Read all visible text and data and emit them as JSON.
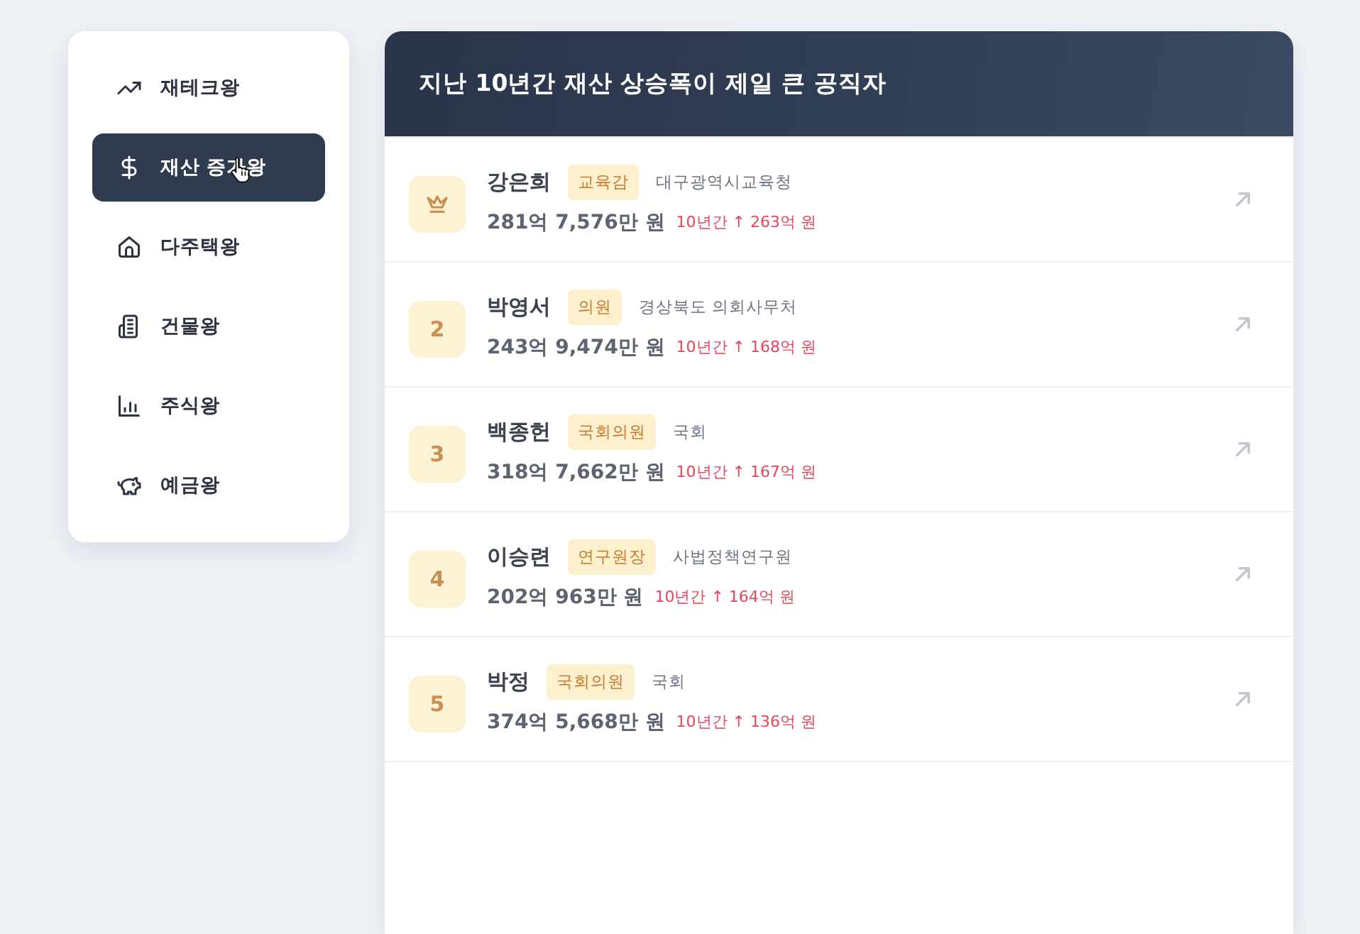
{
  "sidebar": {
    "items": [
      {
        "kind": "trend",
        "label": "재테크왕",
        "selected": false
      },
      {
        "kind": "dollar",
        "label": "재산 증가왕",
        "selected": true
      },
      {
        "kind": "house",
        "label": "다주택왕",
        "selected": false
      },
      {
        "kind": "building",
        "label": "건물왕",
        "selected": false
      },
      {
        "kind": "chart",
        "label": "주식왕",
        "selected": false
      },
      {
        "kind": "piggy",
        "label": "예금왕",
        "selected": false
      }
    ]
  },
  "panel": {
    "title": "지난 10년간 재산 상승폭이 제일 큰 공직자",
    "rows": [
      {
        "kind": "crown",
        "name": "강은희",
        "role": "교육감",
        "org": "대구광역시교육청",
        "amount": "281억 7,576만 원",
        "increase": "10년간 ↑ 263억 원"
      },
      {
        "kind": "number",
        "rank": "2",
        "name": "박영서",
        "role": "의원",
        "org": "경상북도 의회사무처",
        "amount": "243억 9,474만 원",
        "increase": "10년간 ↑ 168억 원"
      },
      {
        "kind": "number",
        "rank": "3",
        "name": "백종헌",
        "role": "국회의원",
        "org": "국회",
        "amount": "318억 7,662만 원",
        "increase": "10년간 ↑ 167억 원"
      },
      {
        "kind": "number",
        "rank": "4",
        "name": "이승련",
        "role": "연구원장",
        "org": "사법정책연구원",
        "amount": "202억 963만 원",
        "increase": "10년간 ↑ 164억 원"
      },
      {
        "kind": "number",
        "rank": "5",
        "name": "박정",
        "role": "국회의원",
        "org": "국회",
        "amount": "374억 5,668만 원",
        "increase": "10년간 ↑ 136억 원"
      }
    ]
  }
}
